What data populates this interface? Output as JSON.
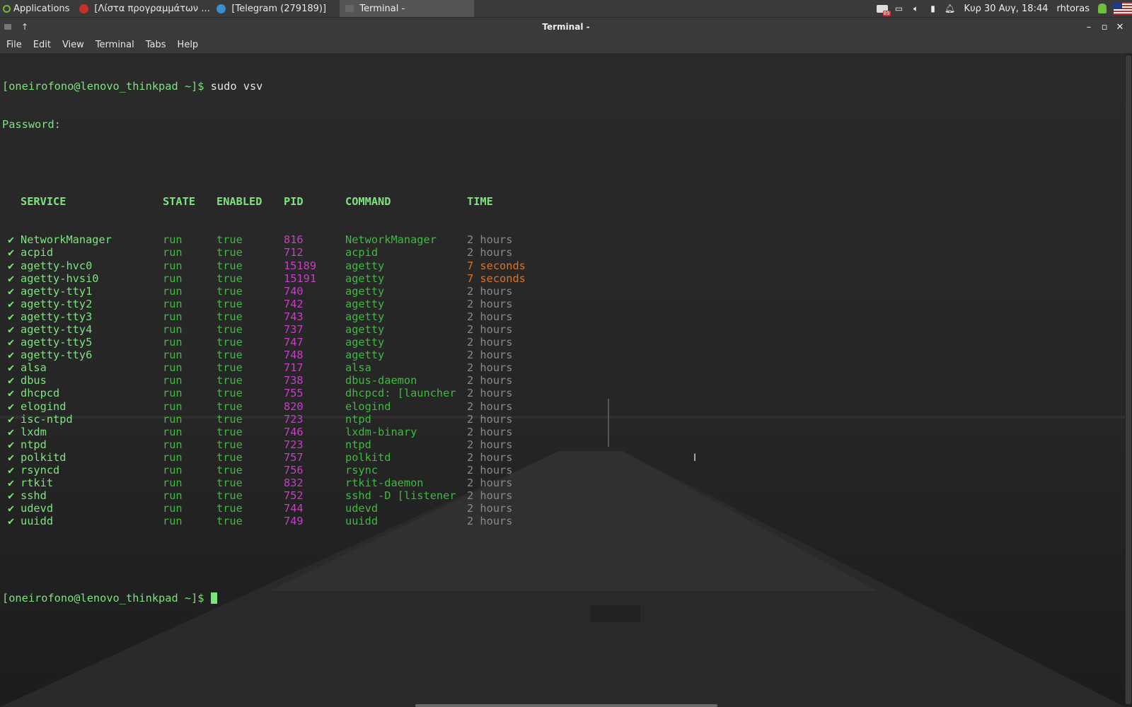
{
  "panel": {
    "app_menu_label": "Applications",
    "tasks": [
      {
        "label": "[Λίστα προγραμμάτων ...",
        "icon": "vivaldi-browser-icon"
      },
      {
        "label": "[Telegram (279189)]",
        "icon": "telegram-icon"
      },
      {
        "label": "Terminal -",
        "icon": "terminal-icon"
      }
    ],
    "mail_badge": "89",
    "clock": "Κυρ 30 Αυγ, 18:44",
    "user": "rhtoras"
  },
  "window": {
    "title": "Terminal -"
  },
  "menubar": {
    "items": [
      "File",
      "Edit",
      "View",
      "Terminal",
      "Tabs",
      "Help"
    ]
  },
  "terminal": {
    "prompt": "[oneirofono@lenovo_thinkpad ~]$ ",
    "command": "sudo vsv",
    "password_line": "Password:",
    "headers": [
      "SERVICE",
      "STATE",
      "ENABLED",
      "PID",
      "COMMAND",
      "TIME"
    ],
    "check_mark": "✔",
    "rows": [
      {
        "service": "NetworkManager",
        "state": "run",
        "enabled": "true",
        "pid": "816",
        "command": "NetworkManager",
        "time": "2 hours",
        "recent": false
      },
      {
        "service": "acpid",
        "state": "run",
        "enabled": "true",
        "pid": "712",
        "command": "acpid",
        "time": "2 hours",
        "recent": false
      },
      {
        "service": "agetty-hvc0",
        "state": "run",
        "enabled": "true",
        "pid": "15189",
        "command": "agetty",
        "time": "7 seconds",
        "recent": true
      },
      {
        "service": "agetty-hvsi0",
        "state": "run",
        "enabled": "true",
        "pid": "15191",
        "command": "agetty",
        "time": "7 seconds",
        "recent": true
      },
      {
        "service": "agetty-tty1",
        "state": "run",
        "enabled": "true",
        "pid": "740",
        "command": "agetty",
        "time": "2 hours",
        "recent": false
      },
      {
        "service": "agetty-tty2",
        "state": "run",
        "enabled": "true",
        "pid": "742",
        "command": "agetty",
        "time": "2 hours",
        "recent": false
      },
      {
        "service": "agetty-tty3",
        "state": "run",
        "enabled": "true",
        "pid": "743",
        "command": "agetty",
        "time": "2 hours",
        "recent": false
      },
      {
        "service": "agetty-tty4",
        "state": "run",
        "enabled": "true",
        "pid": "737",
        "command": "agetty",
        "time": "2 hours",
        "recent": false
      },
      {
        "service": "agetty-tty5",
        "state": "run",
        "enabled": "true",
        "pid": "747",
        "command": "agetty",
        "time": "2 hours",
        "recent": false
      },
      {
        "service": "agetty-tty6",
        "state": "run",
        "enabled": "true",
        "pid": "748",
        "command": "agetty",
        "time": "2 hours",
        "recent": false
      },
      {
        "service": "alsa",
        "state": "run",
        "enabled": "true",
        "pid": "717",
        "command": "alsa",
        "time": "2 hours",
        "recent": false
      },
      {
        "service": "dbus",
        "state": "run",
        "enabled": "true",
        "pid": "738",
        "command": "dbus-daemon",
        "time": "2 hours",
        "recent": false
      },
      {
        "service": "dhcpcd",
        "state": "run",
        "enabled": "true",
        "pid": "755",
        "command": "dhcpcd: [launcher",
        "time": "2 hours",
        "recent": false
      },
      {
        "service": "elogind",
        "state": "run",
        "enabled": "true",
        "pid": "820",
        "command": "elogind",
        "time": "2 hours",
        "recent": false
      },
      {
        "service": "isc-ntpd",
        "state": "run",
        "enabled": "true",
        "pid": "723",
        "command": "ntpd",
        "time": "2 hours",
        "recent": false
      },
      {
        "service": "lxdm",
        "state": "run",
        "enabled": "true",
        "pid": "746",
        "command": "lxdm-binary",
        "time": "2 hours",
        "recent": false
      },
      {
        "service": "ntpd",
        "state": "run",
        "enabled": "true",
        "pid": "723",
        "command": "ntpd",
        "time": "2 hours",
        "recent": false
      },
      {
        "service": "polkitd",
        "state": "run",
        "enabled": "true",
        "pid": "757",
        "command": "polkitd",
        "time": "2 hours",
        "recent": false
      },
      {
        "service": "rsyncd",
        "state": "run",
        "enabled": "true",
        "pid": "756",
        "command": "rsync",
        "time": "2 hours",
        "recent": false
      },
      {
        "service": "rtkit",
        "state": "run",
        "enabled": "true",
        "pid": "832",
        "command": "rtkit-daemon",
        "time": "2 hours",
        "recent": false
      },
      {
        "service": "sshd",
        "state": "run",
        "enabled": "true",
        "pid": "752",
        "command": "sshd -D [listener",
        "time": "2 hours",
        "recent": false
      },
      {
        "service": "udevd",
        "state": "run",
        "enabled": "true",
        "pid": "744",
        "command": "udevd",
        "time": "2 hours",
        "recent": false
      },
      {
        "service": "uuidd",
        "state": "run",
        "enabled": "true",
        "pid": "749",
        "command": "uuidd",
        "time": "2 hours",
        "recent": false
      }
    ]
  }
}
